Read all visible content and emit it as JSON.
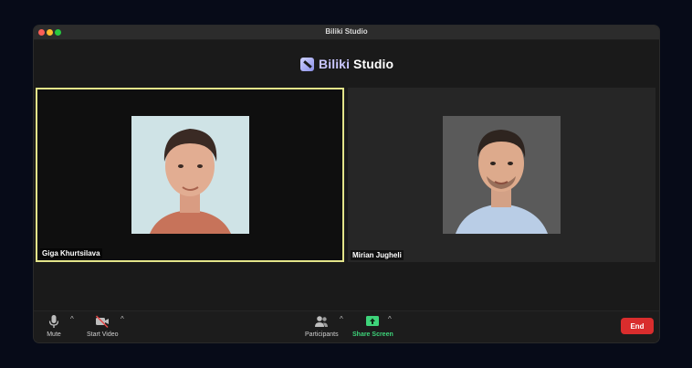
{
  "window": {
    "title": "Biliki Studio"
  },
  "brand": {
    "part1": "Biliki",
    "part2": " Studio"
  },
  "participants": [
    {
      "name": "Giga Khurtsilava",
      "active_speaker": true
    },
    {
      "name": "Mirian Jugheli",
      "active_speaker": false
    }
  ],
  "toolbar": {
    "mute_label": "Mute",
    "start_video_label": "Start Video",
    "participants_label": "Participants",
    "share_screen_label": "Share Screen",
    "end_label": "End"
  },
  "colors": {
    "active_border": "#e3e48a",
    "share_green": "#3ed47a",
    "end_red": "#d92d2d"
  },
  "icons": [
    "microphone-icon",
    "video-off-icon",
    "participants-icon",
    "share-screen-icon",
    "caret-up-icon"
  ]
}
